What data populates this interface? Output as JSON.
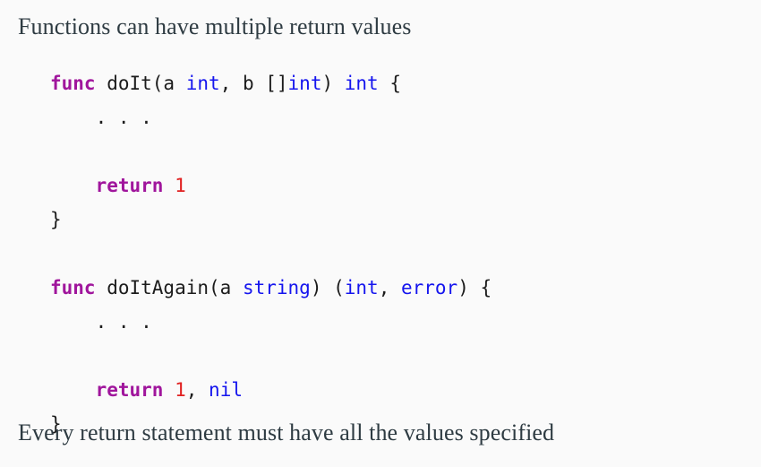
{
  "slide": {
    "background_color": "#fafafa",
    "heading": "Functions can have multiple return values",
    "footer": "Every return statement must have all the values specified"
  },
  "theme": {
    "prose_color": "#2e3b42",
    "keyword_color": "#a0159c",
    "type_color": "#1515ee",
    "number_color": "#e02020",
    "plain_color": "#1c1c1c"
  },
  "code": {
    "language": "go",
    "lines": [
      {
        "id": "line-1",
        "tokens": [
          {
            "text": "func",
            "kind": "keyword"
          },
          {
            "text": " doIt(a ",
            "kind": "plain"
          },
          {
            "text": "int",
            "kind": "type"
          },
          {
            "text": ", b []",
            "kind": "plain"
          },
          {
            "text": "int",
            "kind": "type"
          },
          {
            "text": ") ",
            "kind": "plain"
          },
          {
            "text": "int",
            "kind": "type"
          },
          {
            "text": " {",
            "kind": "plain"
          }
        ]
      },
      {
        "id": "line-2",
        "tokens": [
          {
            "text": "    . . .",
            "kind": "plain"
          }
        ]
      },
      {
        "id": "line-3",
        "tokens": []
      },
      {
        "id": "line-4",
        "tokens": [
          {
            "text": "    ",
            "kind": "plain"
          },
          {
            "text": "return",
            "kind": "keyword"
          },
          {
            "text": " ",
            "kind": "plain"
          },
          {
            "text": "1",
            "kind": "number"
          }
        ]
      },
      {
        "id": "line-5",
        "tokens": [
          {
            "text": "}",
            "kind": "plain"
          }
        ]
      },
      {
        "id": "line-6",
        "tokens": []
      },
      {
        "id": "line-7",
        "tokens": [
          {
            "text": "func",
            "kind": "keyword"
          },
          {
            "text": " doItAgain(a ",
            "kind": "plain"
          },
          {
            "text": "string",
            "kind": "type"
          },
          {
            "text": ") (",
            "kind": "plain"
          },
          {
            "text": "int",
            "kind": "type"
          },
          {
            "text": ", ",
            "kind": "plain"
          },
          {
            "text": "error",
            "kind": "type"
          },
          {
            "text": ") {",
            "kind": "plain"
          }
        ]
      },
      {
        "id": "line-8",
        "tokens": [
          {
            "text": "    . . .",
            "kind": "plain"
          }
        ]
      },
      {
        "id": "line-9",
        "tokens": []
      },
      {
        "id": "line-10",
        "tokens": [
          {
            "text": "    ",
            "kind": "plain"
          },
          {
            "text": "return",
            "kind": "keyword"
          },
          {
            "text": " ",
            "kind": "plain"
          },
          {
            "text": "1",
            "kind": "number"
          },
          {
            "text": ", ",
            "kind": "plain"
          },
          {
            "text": "nil",
            "kind": "type"
          }
        ]
      },
      {
        "id": "line-11",
        "tokens": [
          {
            "text": "}",
            "kind": "plain"
          }
        ]
      }
    ]
  }
}
